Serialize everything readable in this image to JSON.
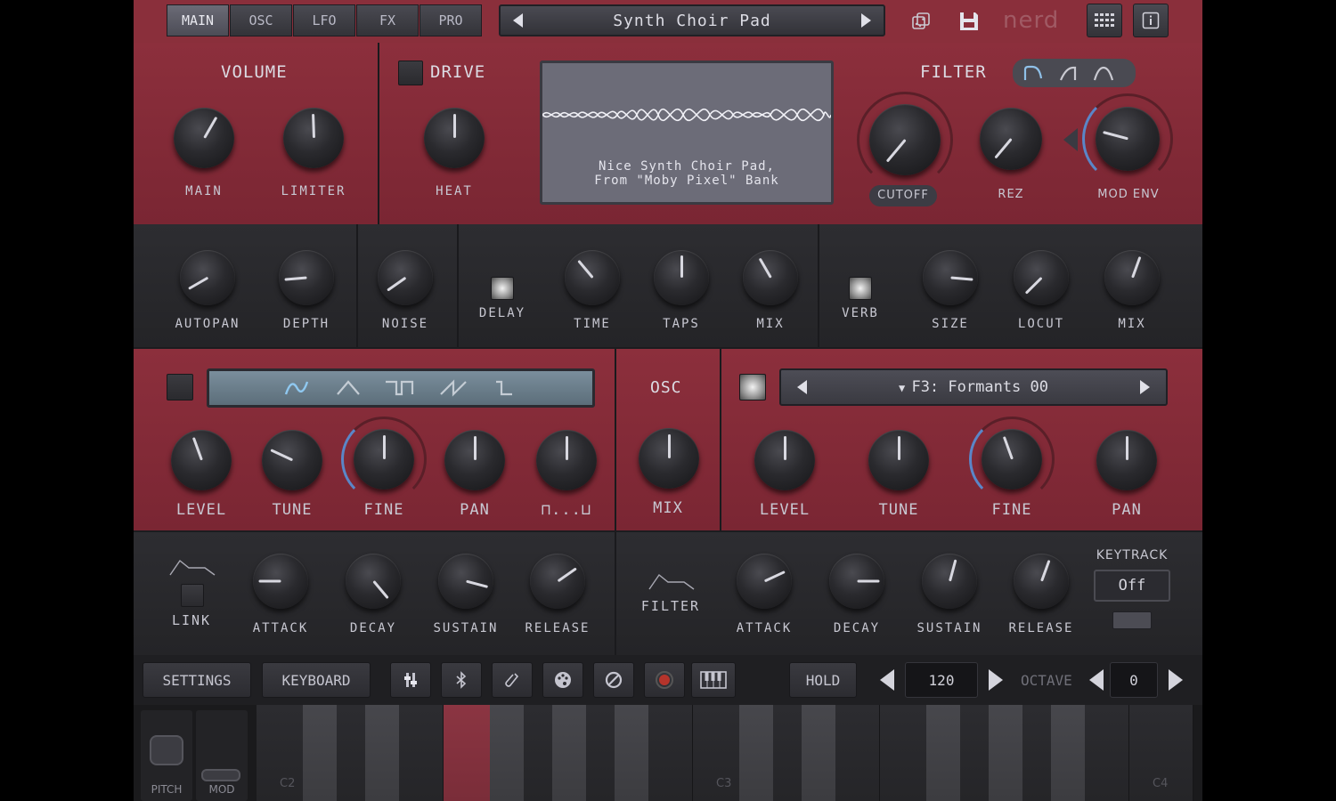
{
  "nav": {
    "tabs": [
      "MAIN",
      "OSC",
      "LFO",
      "FX",
      "PRO"
    ],
    "active_tab": "MAIN",
    "preset_name": "Synth Choir Pad",
    "brand": "nerd"
  },
  "volume": {
    "title": "VOLUME",
    "knobs": [
      "MAIN",
      "LIMITER"
    ]
  },
  "drive": {
    "title": "DRIVE",
    "knob": "HEAT"
  },
  "screen": {
    "line1": "Nice Synth Choir Pad,",
    "line2": "From \"Moby Pixel\" Bank"
  },
  "filter": {
    "title": "FILTER",
    "knobs": [
      "CUTOFF",
      "REZ",
      "MOD ENV"
    ]
  },
  "fx": {
    "knobs": [
      "AUTOPAN",
      "DEPTH",
      "NOISE",
      "TIME",
      "TAPS",
      "MIX",
      "SIZE",
      "LOCUT",
      "MIX"
    ],
    "delay_label": "DELAY",
    "verb_label": "VERB"
  },
  "osc1": {
    "knobs": [
      "LEVEL",
      "TUNE",
      "FINE",
      "PAN"
    ],
    "pw_label": "⊓...⊔"
  },
  "osc_mix": {
    "title": "OSC",
    "knob": "MIX"
  },
  "osc2": {
    "preset": "F3: Formants 00",
    "knobs": [
      "LEVEL",
      "TUNE",
      "FINE",
      "PAN"
    ]
  },
  "amp_env": {
    "link_label": "LINK",
    "knobs": [
      "ATTACK",
      "DECAY",
      "SUSTAIN",
      "RELEASE"
    ]
  },
  "filter_env": {
    "label": "FILTER",
    "knobs": [
      "ATTACK",
      "DECAY",
      "SUSTAIN",
      "RELEASE"
    ],
    "keytrack_label": "KEYTRACK",
    "keytrack_value": "Off"
  },
  "toolbar": {
    "settings": "SETTINGS",
    "keyboard": "KEYBOARD",
    "hold": "HOLD",
    "tempo": "120",
    "octave_label": "OCTAVE",
    "octave": "0"
  },
  "keys": {
    "notes": [
      "C2",
      "C3",
      "C4"
    ],
    "pitch_label": "PITCH",
    "mod_label": "MOD"
  },
  "colors": {
    "panel_red": "#8a2f3b",
    "panel_dark": "#28282b",
    "accent_blue": "#5a86c8"
  }
}
